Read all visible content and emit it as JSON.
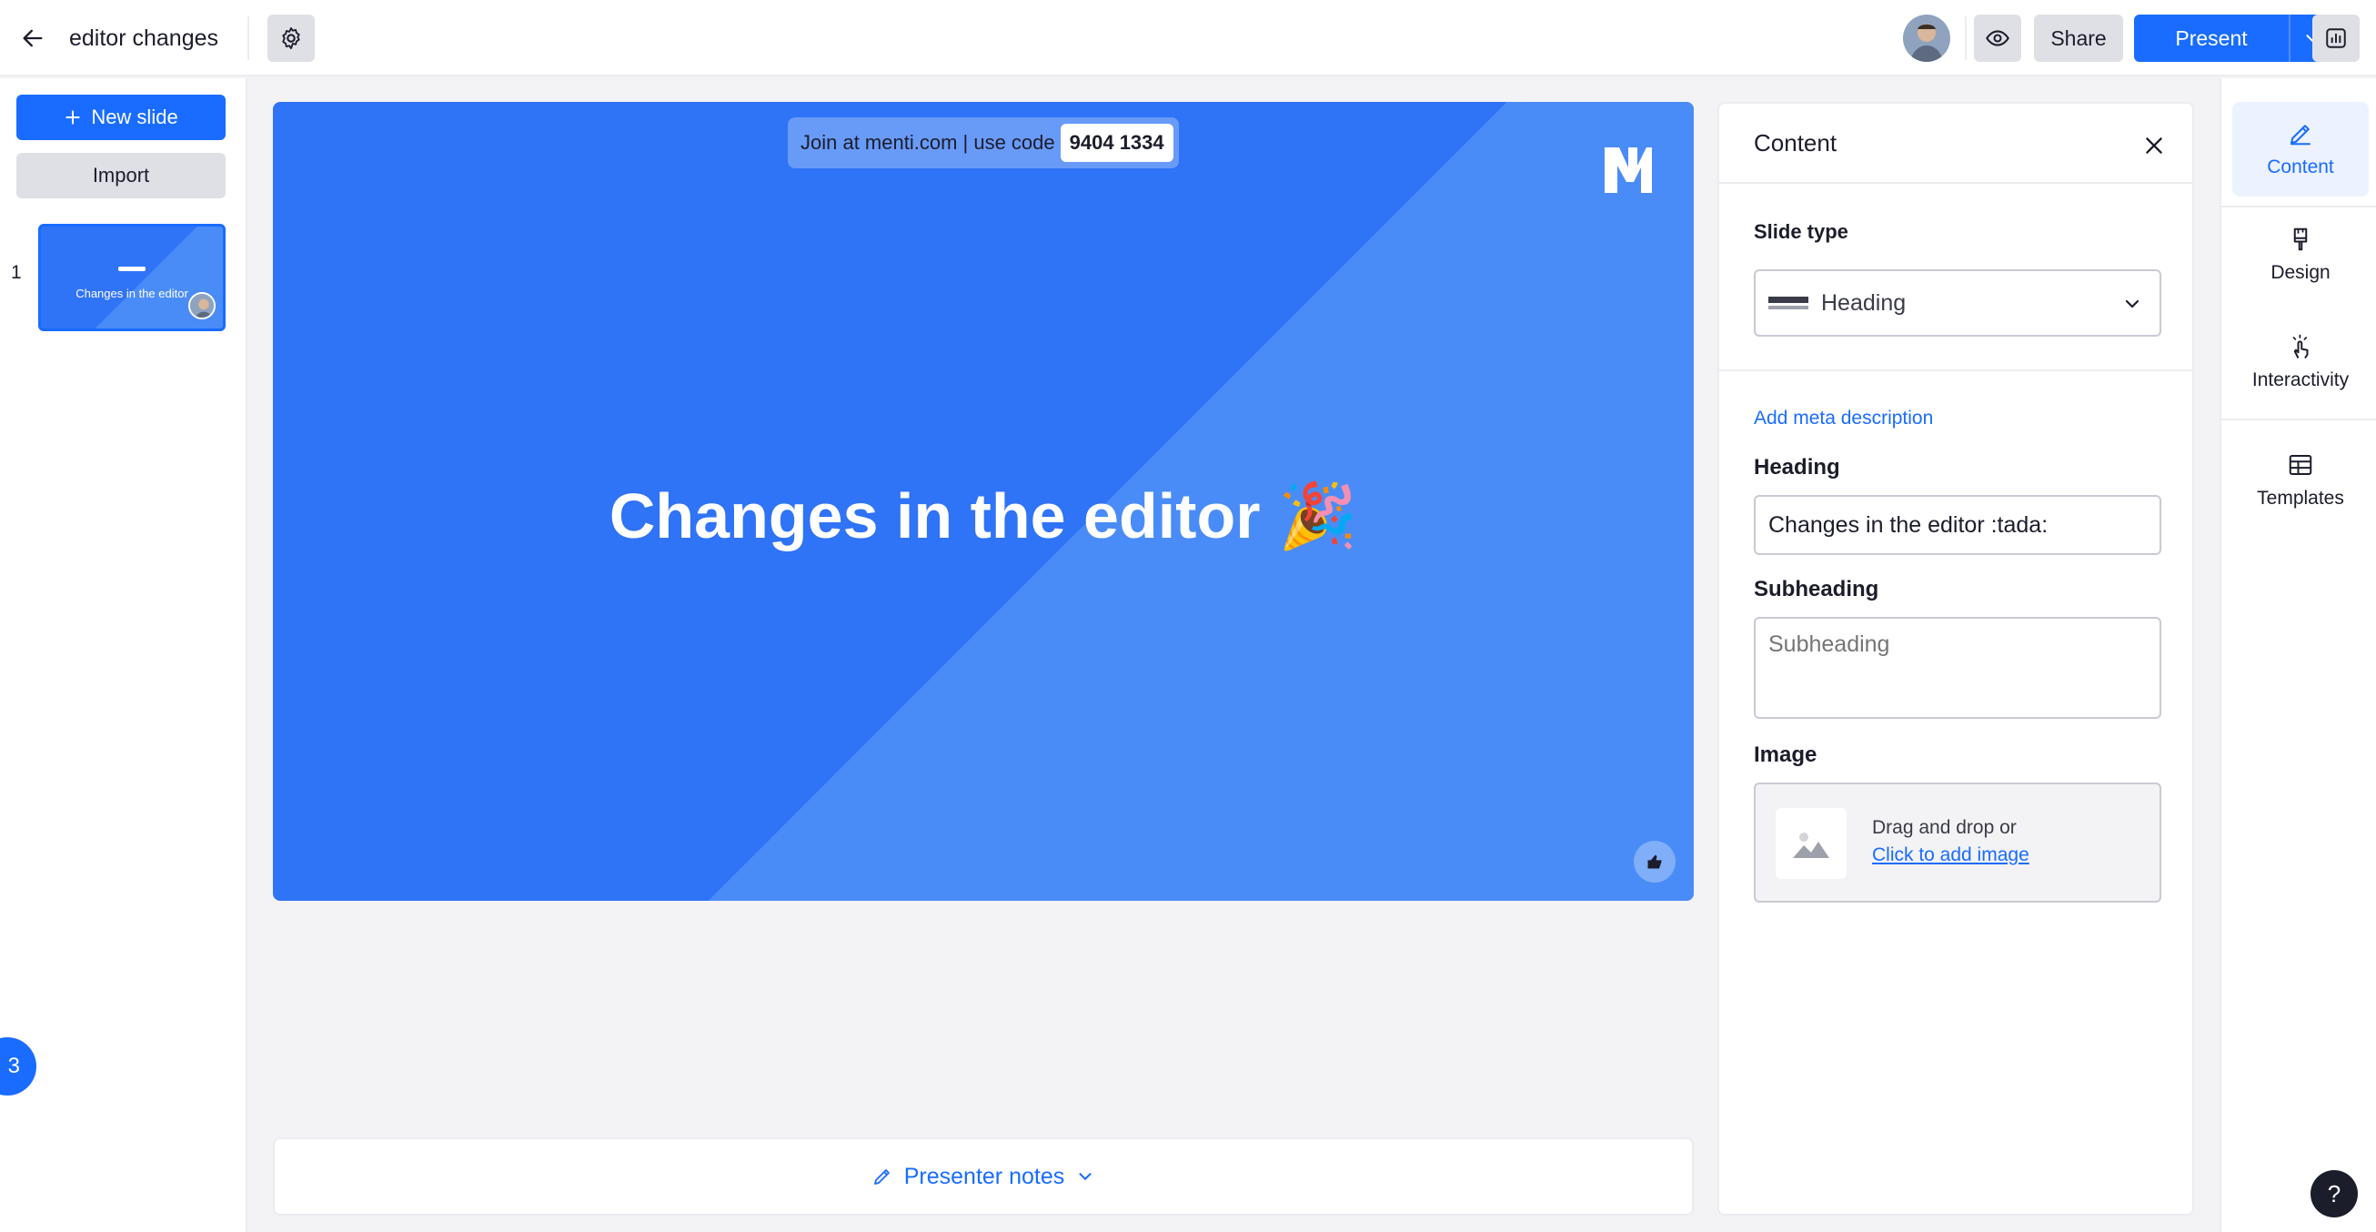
{
  "header": {
    "title": "editor changes",
    "share_label": "Share",
    "present_label": "Present"
  },
  "sidebar": {
    "new_slide_label": "New slide",
    "import_label": "Import",
    "slides": [
      {
        "number": "1",
        "title": "Changes in the editor"
      }
    ],
    "badge_count": "3"
  },
  "slide": {
    "join_text": "Join at menti.com | use code",
    "join_code": "9404 1334",
    "heading": "Changes in the editor",
    "heading_emoji": "🎉"
  },
  "notes": {
    "label": "Presenter notes"
  },
  "content_panel": {
    "title": "Content",
    "slide_type_label": "Slide type",
    "slide_type_value": "Heading",
    "meta_link": "Add meta description",
    "heading_label": "Heading",
    "heading_value": "Changes in the editor :tada:",
    "subheading_label": "Subheading",
    "subheading_placeholder": "Subheading",
    "image_label": "Image",
    "image_drop_text": "Drag and drop or",
    "image_drop_link": "Click to add image"
  },
  "right_rail": {
    "items": [
      {
        "label": "Content",
        "icon": "pencil-icon"
      },
      {
        "label": "Design",
        "icon": "paintbrush-icon"
      },
      {
        "label": "Interactivity",
        "icon": "tap-icon"
      },
      {
        "label": "Templates",
        "icon": "table-icon"
      }
    ],
    "help_label": "?"
  },
  "colors": {
    "accent": "#196cff",
    "slide_bg": "#2f73f6",
    "slide_diag": "#4a8cf7"
  }
}
